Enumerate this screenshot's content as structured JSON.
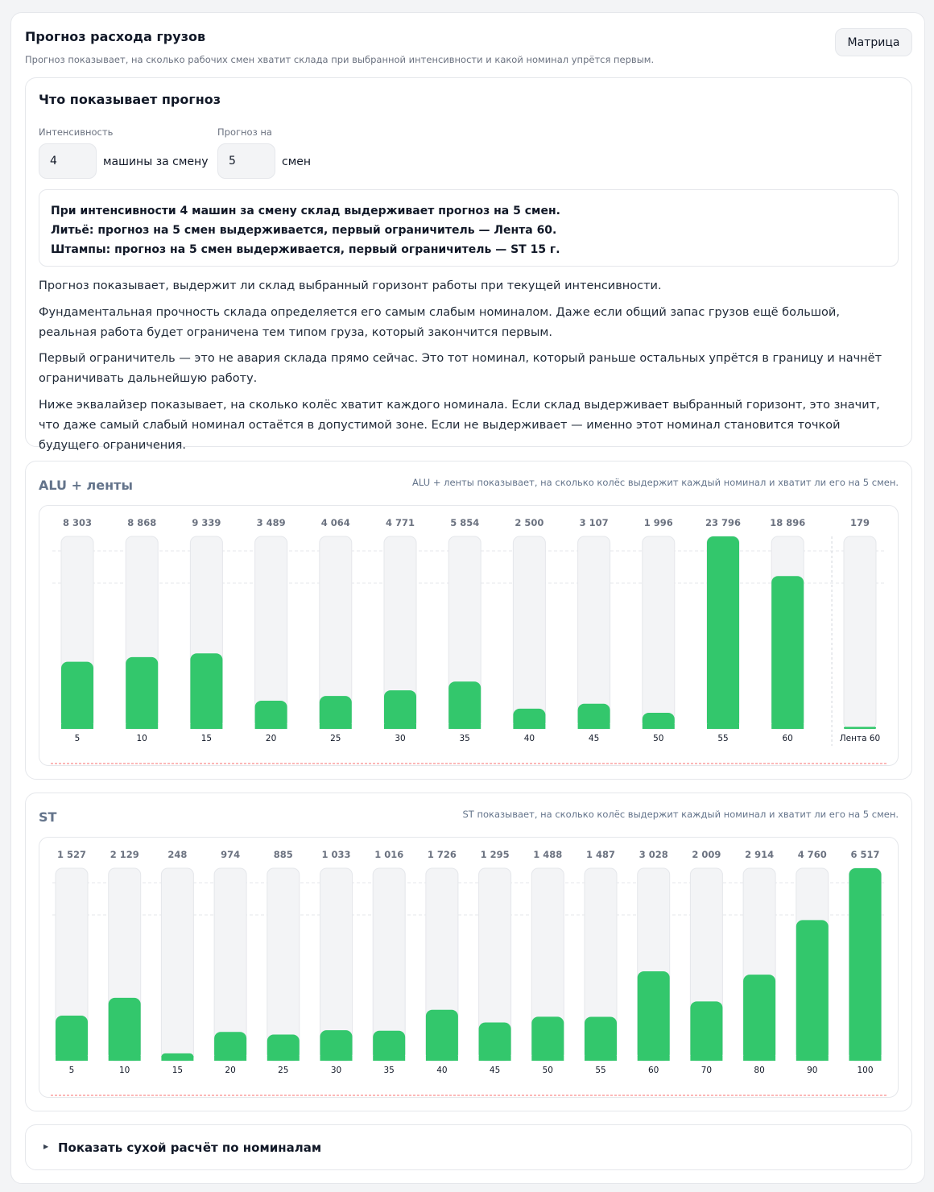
{
  "header": {
    "title": "Прогноз расхода грузов",
    "subtitle": "Прогноз показывает, на сколько рабочих смен хватит склада при выбранной интенсивности и какой номинал упрётся первым.",
    "matrix_button": "Матрица"
  },
  "explain": {
    "title": "Что показывает прогноз",
    "intensity_label": "Интенсивность",
    "intensity_value": "4",
    "intensity_unit": "машины за смену",
    "horizon_label": "Прогноз на",
    "horizon_value": "5",
    "horizon_unit": "смен",
    "summary": [
      "При интенсивности 4 машин за смену склад выдерживает прогноз на 5 смен.",
      "Литьё: прогноз на 5 смен выдерживается, первый ограничитель — Лента 60.",
      "Штампы: прогноз на 5 смен выдерживается, первый ограничитель — ST 15 г."
    ],
    "paragraphs": [
      "Прогноз показывает, выдержит ли склад выбранный горизонт работы при текущей интенсивности.",
      "Фундаментальная прочность склада определяется его самым слабым номиналом. Даже если общий запас грузов ещё большой, реальная работа будет ограничена тем типом груза, который закончится первым.",
      "Первый ограничитель — это не авария склада прямо сейчас. Это тот номинал, который раньше остальных упрётся в границу и начнёт ограничивать дальнейшую работу.",
      "Ниже эквалайзер показывает, на сколько колёс хватит каждого номинала. Если склад выдерживает выбранный горизонт, это значит, что даже самый слабый номинал остаётся в допустимой зоне. Если не выдерживает — именно этот номинал становится точкой будущего ограничения."
    ]
  },
  "chart_data": [
    {
      "type": "bar",
      "title": "ALU + ленты",
      "note": "ALU + ленты показывает, на сколько колёс выдержит каждый номинал и хватит ли его на 5 смен.",
      "categories": [
        "5",
        "10",
        "15",
        "20",
        "25",
        "30",
        "35",
        "40",
        "45",
        "50",
        "55",
        "60",
        "Лента 60"
      ],
      "values": [
        8303,
        8868,
        9339,
        3489,
        4064,
        4771,
        5854,
        2500,
        3107,
        1996,
        23796,
        18896,
        179
      ],
      "value_labels": [
        "8 303",
        "8 868",
        "9 339",
        "3 489",
        "4 064",
        "4 771",
        "5 854",
        "2 500",
        "3 107",
        "1 996",
        "23 796",
        "18 896",
        "179"
      ],
      "separated_last": true,
      "bar_color": "#33c76c",
      "track_color": "#f3f4f6"
    },
    {
      "type": "bar",
      "title": "ST",
      "note": "ST показывает, на сколько колёс выдержит каждый номинал и хватит ли его на 5 смен.",
      "categories": [
        "5",
        "10",
        "15",
        "20",
        "25",
        "30",
        "35",
        "40",
        "45",
        "50",
        "55",
        "60",
        "70",
        "80",
        "90",
        "100"
      ],
      "values": [
        1527,
        2129,
        248,
        974,
        885,
        1033,
        1016,
        1726,
        1295,
        1488,
        1487,
        3028,
        2009,
        2914,
        4760,
        6517
      ],
      "value_labels": [
        "1 527",
        "2 129",
        "248",
        "974",
        "885",
        "1 033",
        "1 016",
        "1 726",
        "1 295",
        "1 488",
        "1 487",
        "3 028",
        "2 009",
        "2 914",
        "4 760",
        "6 517"
      ],
      "separated_last": false,
      "bar_color": "#33c76c",
      "track_color": "#f3f4f6"
    }
  ],
  "details": {
    "label": "Показать сухой расчёт по номиналам"
  }
}
